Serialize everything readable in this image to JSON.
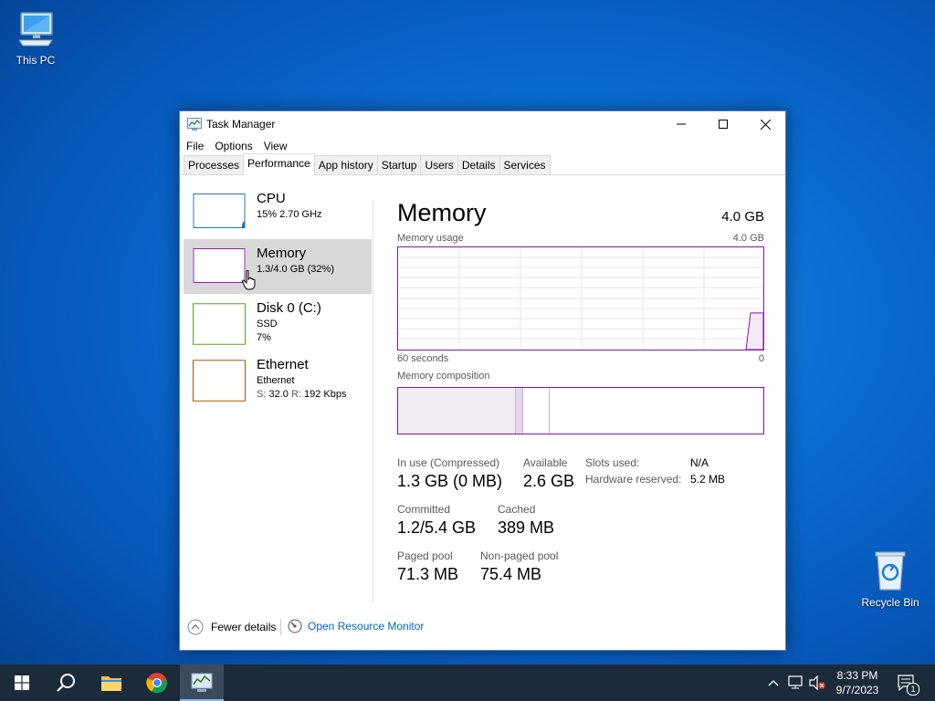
{
  "desktop": {
    "this_pc_label": "This PC",
    "recycle_bin_label": "Recycle Bin"
  },
  "window": {
    "title": "Task Manager",
    "menu": [
      "File",
      "Options",
      "View"
    ],
    "tabs": [
      "Processes",
      "Performance",
      "App history",
      "Startup",
      "Users",
      "Details",
      "Services"
    ],
    "active_tab": "Performance"
  },
  "sidebar": [
    {
      "name": "CPU",
      "line1": "15%  2.70 GHz",
      "line2": "",
      "color": "#1a6fb5"
    },
    {
      "name": "Memory",
      "line1": "1.3/4.0 GB (32%)",
      "line2": "",
      "color": "#8b12ae"
    },
    {
      "name": "Disk 0 (C:)",
      "line1": "SSD",
      "line2": "7%",
      "color": "#4da60c"
    },
    {
      "name": "Ethernet",
      "line1": "Ethernet",
      "line2_s_label": "S:",
      "line2_s_val": "32.0",
      "line2_r_label": "R:",
      "line2_r_val": "192 Kbps",
      "color": "#a74f01"
    }
  ],
  "memory": {
    "title": "Memory",
    "total": "4.0 GB",
    "usage_label": "Memory usage",
    "usage_max": "4.0 GB",
    "time_left": "60 seconds",
    "time_right": "0",
    "composition_label": "Memory composition",
    "stats": {
      "in_use_label": "In use (Compressed)",
      "in_use_value": "1.3 GB (0 MB)",
      "available_label": "Available",
      "available_value": "2.6 GB",
      "committed_label": "Committed",
      "committed_value": "1.2/5.4 GB",
      "cached_label": "Cached",
      "cached_value": "389 MB",
      "paged_label": "Paged pool",
      "paged_value": "71.3 MB",
      "nonpaged_label": "Non-paged pool",
      "nonpaged_value": "75.4 MB",
      "slots_label": "Slots used:",
      "slots_value": "N/A",
      "hw_reserved_label": "Hardware reserved:",
      "hw_reserved_value": "5.2 MB"
    },
    "usage_fraction": 0.32,
    "composition": {
      "in_use": 0.32,
      "modified": 0.02,
      "standby": 0.07
    }
  },
  "footer": {
    "fewer_details": "Fewer details",
    "open_resource_monitor": "Open Resource Monitor"
  },
  "taskbar": {
    "time": "8:33 PM",
    "date": "9/7/2023",
    "notification_count": "1"
  },
  "colors": {
    "memory_accent": "#8b12ae",
    "link": "#0066cc",
    "taskbar": "#1c2b3a"
  }
}
